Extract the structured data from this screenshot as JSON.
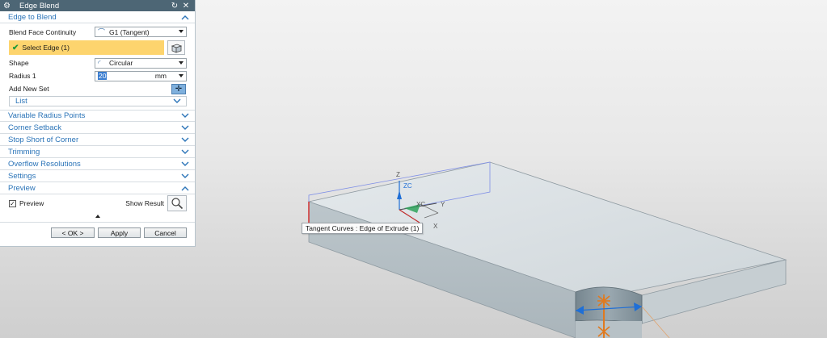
{
  "dialog": {
    "title": "Edge Blend",
    "edge_to_blend": {
      "header": "Edge to Blend",
      "blend_face_continuity_label": "Blend Face Continuity",
      "blend_face_continuity_value": "G1 (Tangent)",
      "select_edge_label": "Select Edge (1)",
      "shape_label": "Shape",
      "shape_value": "Circular",
      "radius_label": "Radius 1",
      "radius_value": "20",
      "radius_unit": "mm",
      "add_new_set_label": "Add New Set",
      "list_label": "List"
    },
    "sections": [
      {
        "label": "Variable Radius Points"
      },
      {
        "label": "Corner Setback"
      },
      {
        "label": "Stop Short of Corner"
      },
      {
        "label": "Trimming"
      },
      {
        "label": "Overflow Resolutions"
      },
      {
        "label": "Settings"
      }
    ],
    "preview": {
      "header": "Preview",
      "checkbox_label": "Preview",
      "checked": true,
      "show_result_label": "Show Result"
    },
    "buttons": {
      "ok": "< OK >",
      "apply": "Apply",
      "cancel": "Cancel"
    }
  },
  "viewport": {
    "tooltip": "Tangent Curves : Edge of Extrude (1)",
    "axes": {
      "z": "Z",
      "zc": "ZC",
      "xc": "XC",
      "y": "Y",
      "yc": "YC",
      "x": "X"
    }
  },
  "colors": {
    "titlebar": "#4d6675",
    "section_header_text": "#2b74b8",
    "select_highlight": "#fdd46e",
    "solid_face": "#c9d1d5",
    "marker_orange": "#e07a1f",
    "marker_blue": "#1f6fd6"
  },
  "icons": {
    "dialog": "gear-icon",
    "reset": "reset-icon",
    "close": "close-icon",
    "continuity": "curve-continuity-icon",
    "shape": "circular-shape-icon",
    "select": "checkmark-icon",
    "selector": "cube-select-icon",
    "add_set": "add-set-icon",
    "show_result": "magnifier-icon"
  }
}
